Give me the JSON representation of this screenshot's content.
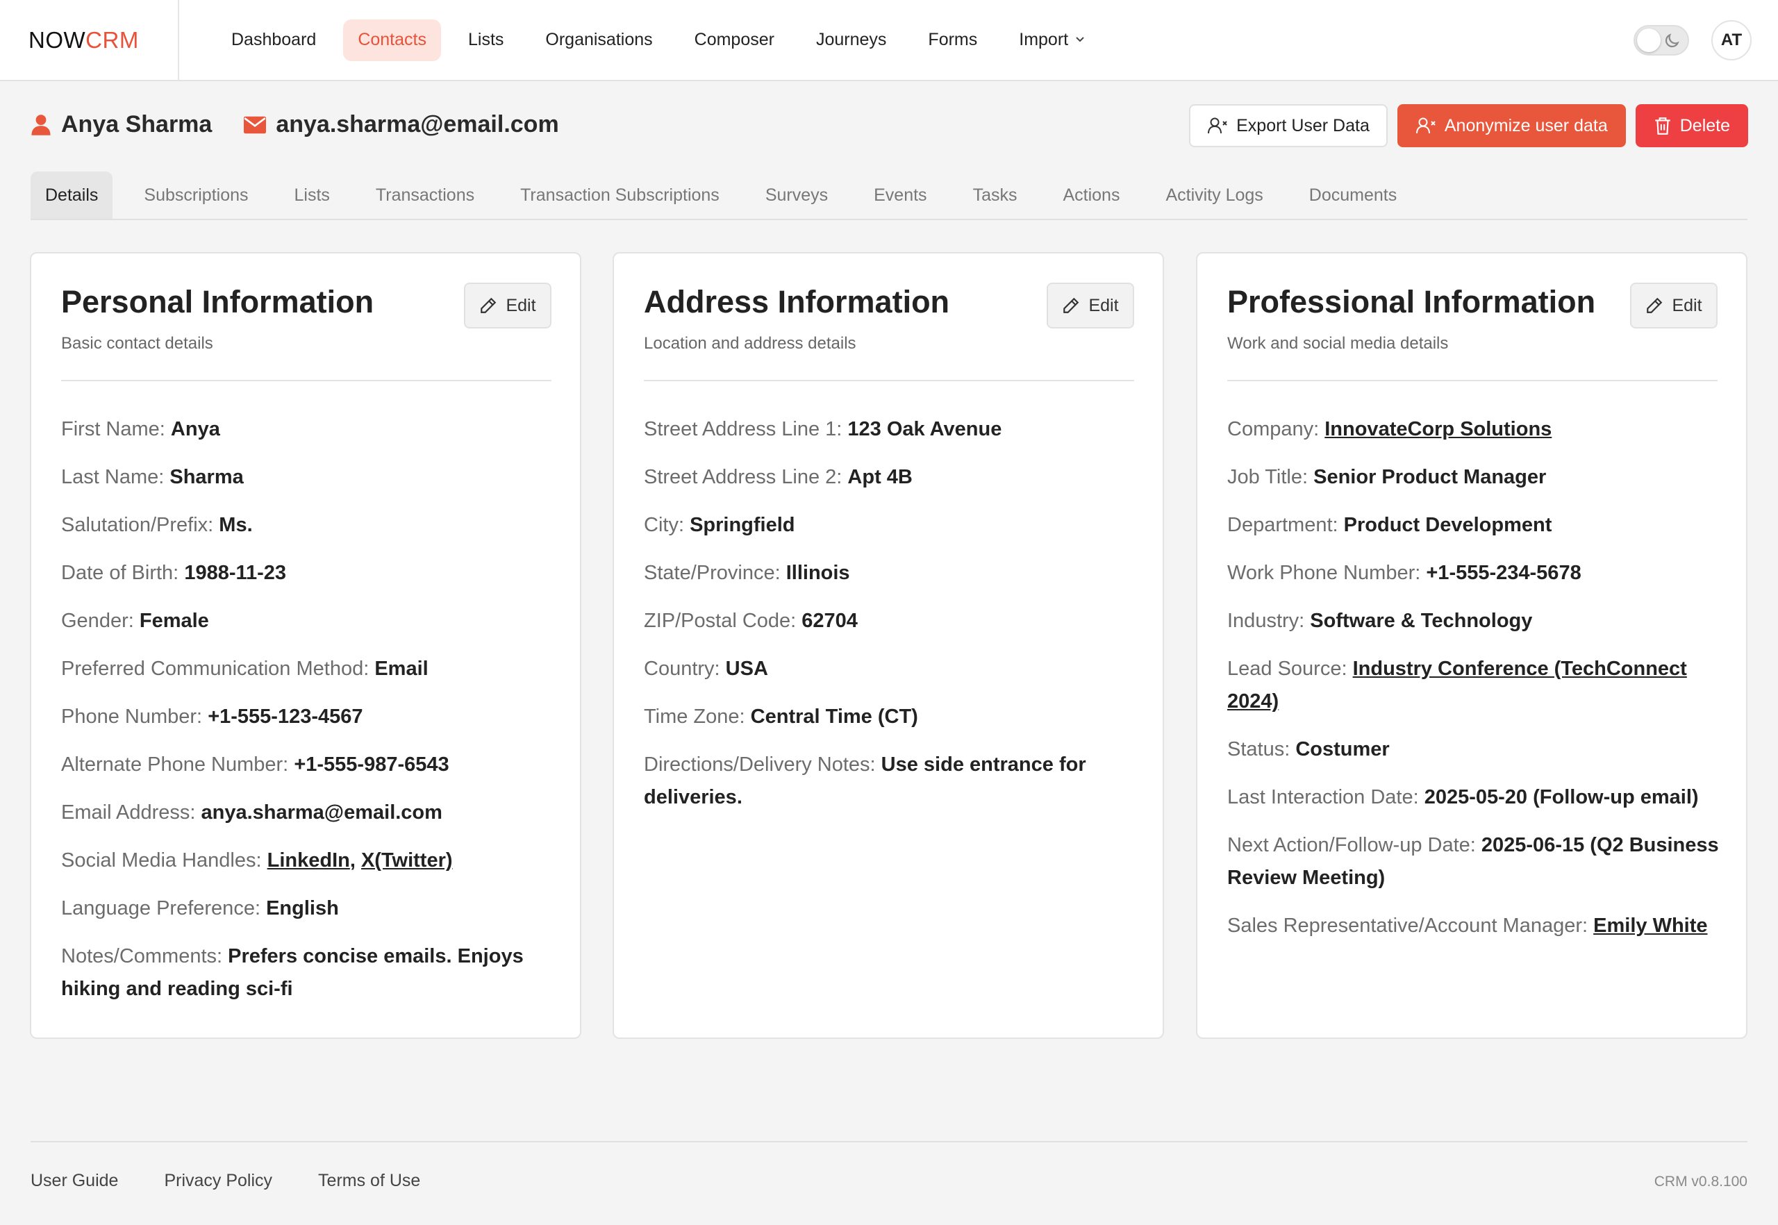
{
  "app": {
    "logo_prefix": "NOW",
    "logo_suffix": "CRM",
    "user_initials": "AT"
  },
  "nav": {
    "items": [
      {
        "label": "Dashboard",
        "active": false
      },
      {
        "label": "Contacts",
        "active": true
      },
      {
        "label": "Lists",
        "active": false
      },
      {
        "label": "Organisations",
        "active": false
      },
      {
        "label": "Composer",
        "active": false
      },
      {
        "label": "Journeys",
        "active": false
      },
      {
        "label": "Forms",
        "active": false
      },
      {
        "label": "Import",
        "active": false
      }
    ],
    "import_icon": "chevron-down-icon"
  },
  "contact": {
    "name": "Anya Sharma",
    "email": "anya.sharma@email.com"
  },
  "actions": {
    "export": "Export User Data",
    "anonymize": "Anonymize user data",
    "delete": "Delete"
  },
  "tabs": [
    "Details",
    "Subscriptions",
    "Lists",
    "Transactions",
    "Transaction Subscriptions",
    "Surveys",
    "Events",
    "Tasks",
    "Actions",
    "Activity Logs",
    "Documents"
  ],
  "edit_label": "Edit",
  "personal": {
    "title": "Personal Information",
    "subtitle": "Basic contact details",
    "fields": [
      {
        "label": "First Name:",
        "value": "Anya"
      },
      {
        "label": "Last Name:",
        "value": "Sharma"
      },
      {
        "label": "Salutation/Prefix:",
        "value": "Ms."
      },
      {
        "label": "Date of Birth:",
        "value": "1988-11-23"
      },
      {
        "label": "Gender:",
        "value": "Female"
      },
      {
        "label": "Preferred Communication Method:",
        "value": "Email"
      },
      {
        "label": "Phone Number:",
        "value": "+1-555-123-4567"
      },
      {
        "label": "Alternate Phone Number:",
        "value": "+1-555-987-6543"
      },
      {
        "label": "Email Address:",
        "value": "anya.sharma@email.com"
      },
      {
        "label": "Social Media Handles:",
        "link1": "LinkedIn",
        "sep": ",",
        "link2": "X(Twitter)"
      },
      {
        "label": "Language Preference:",
        "value": "English"
      },
      {
        "label": "Notes/Comments:",
        "value": "Prefers concise emails. Enjoys hiking and reading sci-fi"
      }
    ]
  },
  "address": {
    "title": "Address Information",
    "subtitle": "Location and address details",
    "fields": [
      {
        "label": "Street Address Line 1:",
        "value": "123 Oak Avenue"
      },
      {
        "label": "Street Address Line 2:",
        "value": "Apt 4B"
      },
      {
        "label": "City:",
        "value": "Springfield"
      },
      {
        "label": "State/Province:",
        "value": "Illinois"
      },
      {
        "label": "ZIP/Postal Code:",
        "value": "62704"
      },
      {
        "label": "Country:",
        "value": "USA"
      },
      {
        "label": "Time Zone:",
        "value": "Central Time (CT)"
      },
      {
        "label": "Directions/Delivery Notes:",
        "value": "Use side entrance for deliveries."
      }
    ]
  },
  "professional": {
    "title": "Professional Information",
    "subtitle": "Work and social media details",
    "fields": [
      {
        "label": "Company:",
        "link": "InnovateCorp Solutions"
      },
      {
        "label": "Job Title:",
        "value": "Senior Product Manager"
      },
      {
        "label": "Department:",
        "value": "Product Development"
      },
      {
        "label": "Work Phone Number:",
        "value": "+1-555-234-5678"
      },
      {
        "label": "Industry:",
        "value": "Software & Technology"
      },
      {
        "label": "Lead Source:",
        "link": "Industry Conference (TechConnect 2024)"
      },
      {
        "label": "Status:",
        "value": "Costumer"
      },
      {
        "label": "Last Interaction Date:",
        "value": "2025-05-20 (Follow-up email)"
      },
      {
        "label": "Next Action/Follow-up Date:",
        "value": "2025-06-15 (Q2 Business Review Meeting)"
      },
      {
        "label": "Sales Representative/Account Manager:",
        "link": "Emily White"
      }
    ]
  },
  "footer": {
    "links": [
      "User Guide",
      "Privacy Policy",
      "Terms of Use"
    ],
    "version": "CRM v0.8.100"
  },
  "colors": {
    "brand": "#e8523a",
    "orange_button": "#e8563b",
    "delete_button": "#ee4043"
  }
}
